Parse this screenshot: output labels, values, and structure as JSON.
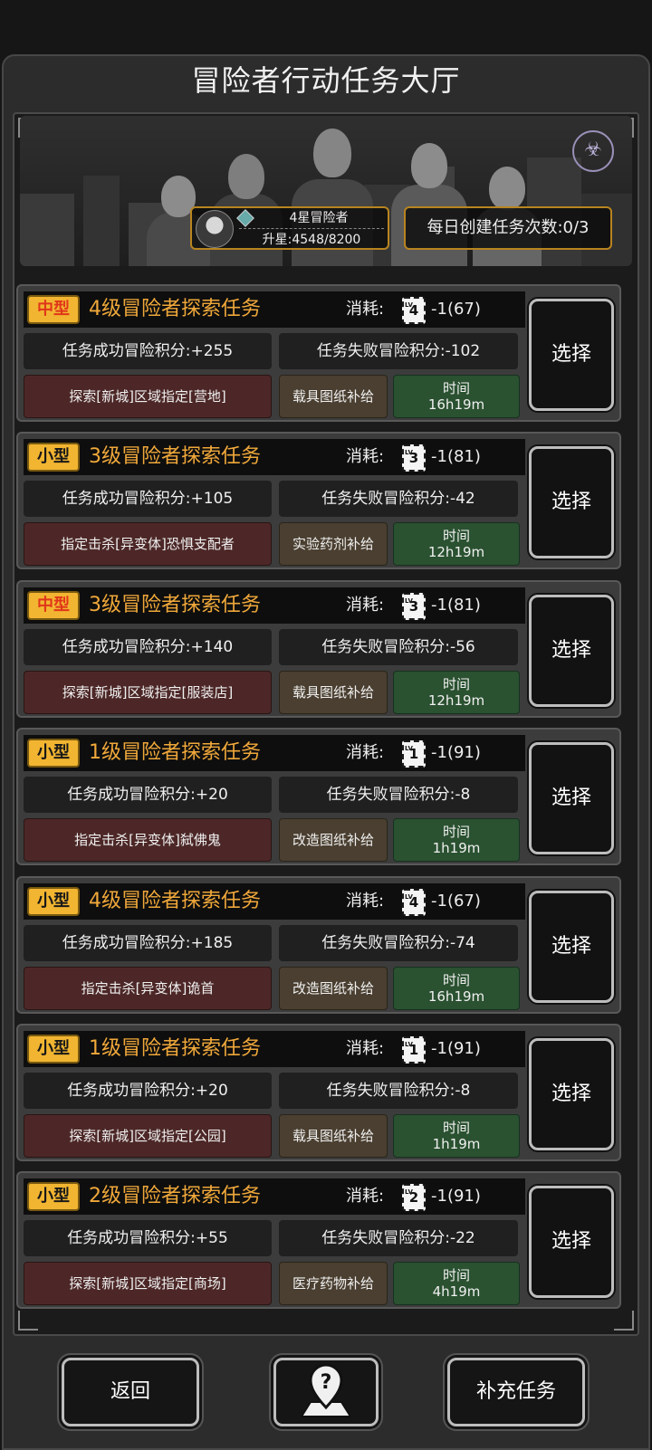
{
  "header": {
    "title": "冒险者行动任务大厅"
  },
  "rank": {
    "name": "4星冒险者",
    "progress": "升星:4548/8200"
  },
  "daily": {
    "label": "每日创建任务次数:0/3"
  },
  "cost_label": "消耗:",
  "select_label": "选择",
  "time_label": "时间",
  "tasks": [
    {
      "size": "中型",
      "size_type": "mid",
      "title": "4级冒险者探索任务",
      "ticket_level": "4",
      "cost": "-1(67)",
      "success": "任务成功冒险积分:+255",
      "fail": "任务失败冒险积分:-102",
      "target": "探索[新城]区域指定[营地]",
      "reward": "载具图纸补给",
      "time": "16h19m"
    },
    {
      "size": "小型",
      "size_type": "small",
      "title": "3级冒险者探索任务",
      "ticket_level": "3",
      "cost": "-1(81)",
      "success": "任务成功冒险积分:+105",
      "fail": "任务失败冒险积分:-42",
      "target": "指定击杀[异变体]恐惧支配者",
      "reward": "实验药剂补给",
      "time": "12h19m"
    },
    {
      "size": "中型",
      "size_type": "mid",
      "title": "3级冒险者探索任务",
      "ticket_level": "3",
      "cost": "-1(81)",
      "success": "任务成功冒险积分:+140",
      "fail": "任务失败冒险积分:-56",
      "target": "探索[新城]区域指定[服装店]",
      "reward": "载具图纸补给",
      "time": "12h19m"
    },
    {
      "size": "小型",
      "size_type": "small",
      "title": "1级冒险者探索任务",
      "ticket_level": "1",
      "cost": "-1(91)",
      "success": "任务成功冒险积分:+20",
      "fail": "任务失败冒险积分:-8",
      "target": "指定击杀[异变体]弑佛鬼",
      "reward": "改造图纸补给",
      "time": "1h19m"
    },
    {
      "size": "小型",
      "size_type": "small",
      "title": "4级冒险者探索任务",
      "ticket_level": "4",
      "cost": "-1(67)",
      "success": "任务成功冒险积分:+185",
      "fail": "任务失败冒险积分:-74",
      "target": "指定击杀[异变体]诡首",
      "reward": "改造图纸补给",
      "time": "16h19m"
    },
    {
      "size": "小型",
      "size_type": "small",
      "title": "1级冒险者探索任务",
      "ticket_level": "1",
      "cost": "-1(91)",
      "success": "任务成功冒险积分:+20",
      "fail": "任务失败冒险积分:-8",
      "target": "探索[新城]区域指定[公园]",
      "reward": "载具图纸补给",
      "time": "1h19m"
    },
    {
      "size": "小型",
      "size_type": "small",
      "title": "2级冒险者探索任务",
      "ticket_level": "2",
      "cost": "-1(91)",
      "success": "任务成功冒险积分:+55",
      "fail": "任务失败冒险积分:-22",
      "target": "探索[新城]区域指定[商场]",
      "reward": "医疗药物补给",
      "time": "4h19m"
    }
  ],
  "footer": {
    "back_label": "返回",
    "refill_label": "补充任务"
  }
}
